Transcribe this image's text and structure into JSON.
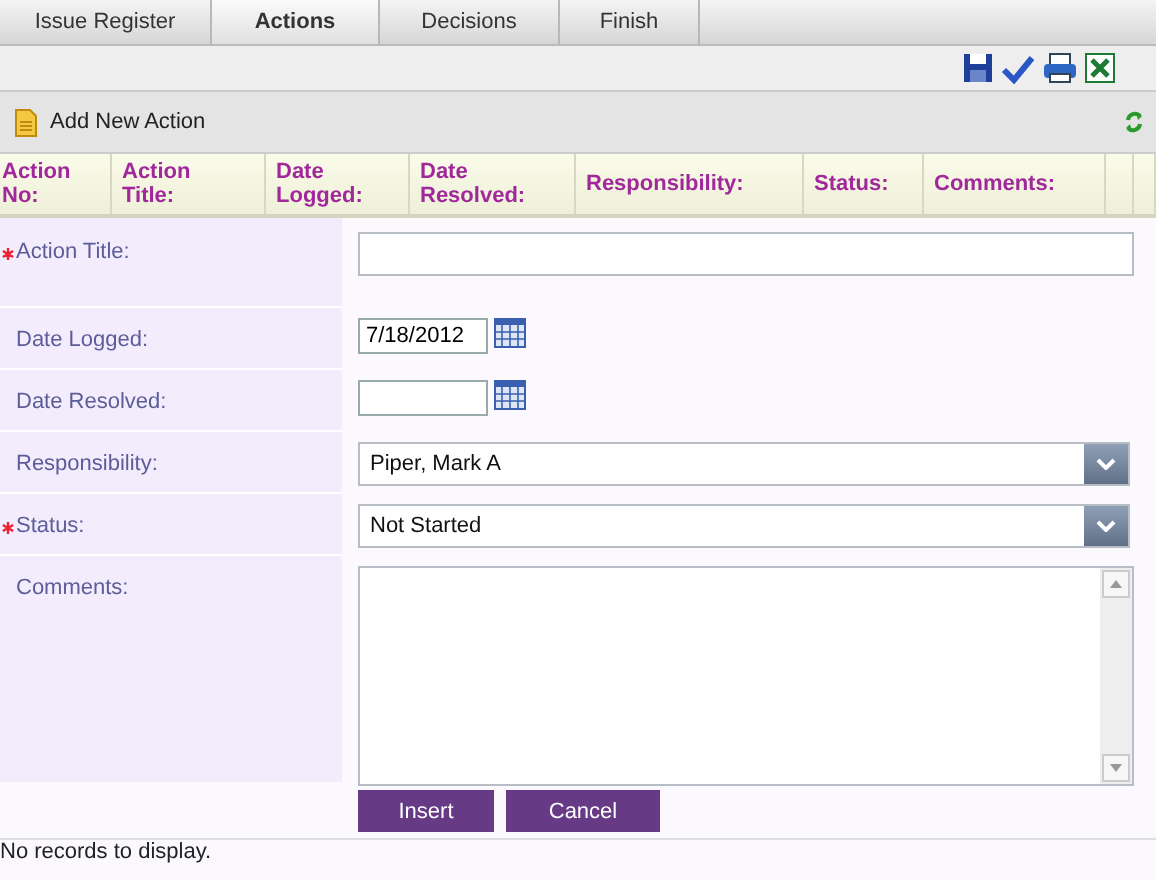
{
  "tabs": [
    {
      "label": "Issue Register",
      "selected": false
    },
    {
      "label": "Actions",
      "selected": true
    },
    {
      "label": "Decisions",
      "selected": false
    },
    {
      "label": "Finish",
      "selected": false
    }
  ],
  "add_button": {
    "label": "Add New Action"
  },
  "columns": [
    "Action No:",
    "Action Title:",
    "Date Logged:",
    "Date Resolved:",
    "Responsibility:",
    "Status:",
    "Comments:"
  ],
  "fields": [
    {
      "label": "Action Title:",
      "required": true,
      "kind": "text"
    },
    {
      "label": "Date Logged:",
      "required": false,
      "kind": "date",
      "value": "7/18/2012"
    },
    {
      "label": "Date Resolved:",
      "required": false,
      "kind": "date"
    },
    {
      "label": "Responsibility:",
      "required": false,
      "kind": "select",
      "value": "Piper, Mark A"
    },
    {
      "label": "Status:",
      "required": true,
      "kind": "select",
      "value": "Not Started"
    },
    {
      "label": "Comments:",
      "required": false,
      "kind": "textarea"
    }
  ],
  "buttons": [
    "Insert",
    "Cancel"
  ],
  "footer": "No records to display."
}
